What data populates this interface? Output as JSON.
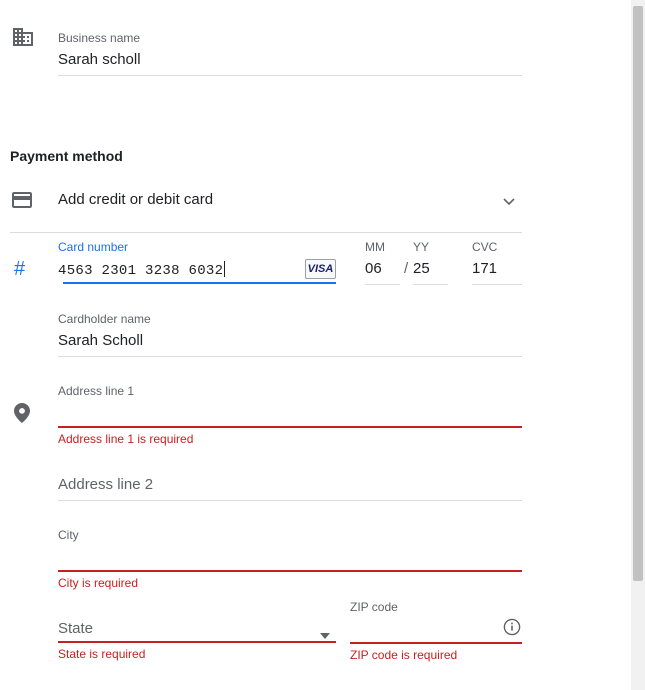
{
  "business": {
    "label": "Business name",
    "value": "Sarah scholl"
  },
  "payment": {
    "section_title": "Payment method",
    "add_card_label": "Add credit or debit card"
  },
  "card": {
    "number_label": "Card number",
    "number_value": "4563 2301 3238 6032",
    "brand": "VISA",
    "mm_label": "MM",
    "mm_value": "06",
    "slash": "/",
    "yy_label": "YY",
    "yy_value": "25",
    "cvc_label": "CVC",
    "cvc_value": "171",
    "holder_label": "Cardholder name",
    "holder_value": "Sarah Scholl"
  },
  "address": {
    "line1_label": "Address line 1",
    "line1_value": "",
    "line1_error": "Address line 1 is required",
    "line2_placeholder": "Address line 2",
    "city_label": "City",
    "city_value": "",
    "city_error": "City is required",
    "state_placeholder": "State",
    "state_error": "State is required",
    "zip_label": "ZIP code",
    "zip_value": "",
    "zip_error": "ZIP code is required"
  },
  "icons": {
    "building": "building-icon",
    "card": "credit-card-icon",
    "hash": "#",
    "location": "location-pin-icon",
    "chevron": "chevron-down-icon",
    "dropdown": "dropdown-arrow-icon",
    "info": "info-icon"
  },
  "colors": {
    "accent": "#1a73e8",
    "error": "#c5221f",
    "divider": "#dadce0"
  }
}
